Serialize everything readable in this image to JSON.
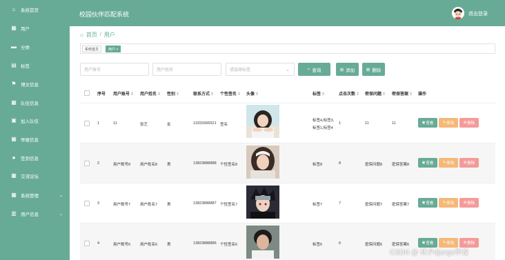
{
  "app": {
    "title": "校园伙伴匹配系统",
    "logout": "退出登录"
  },
  "sidebar": {
    "items": [
      {
        "label": "系统首页",
        "icon": "home-icon"
      },
      {
        "label": "用户",
        "icon": "grid-icon"
      },
      {
        "label": "分类",
        "icon": "card-icon"
      },
      {
        "label": "标签",
        "icon": "doc-icon"
      },
      {
        "label": "博文信息",
        "icon": "flag-icon"
      },
      {
        "label": "队伍信息",
        "icon": "grid-icon"
      },
      {
        "label": "加入队伍",
        "icon": "screen-icon"
      },
      {
        "label": "举报信息",
        "icon": "grid-icon"
      },
      {
        "label": "签到信息",
        "icon": "person-icon"
      },
      {
        "label": "交流论坛",
        "icon": "grid-icon"
      },
      {
        "label": "系统管理",
        "icon": "grid-icon"
      },
      {
        "label": "用户信息",
        "icon": "calendar-icon"
      }
    ]
  },
  "breadcrumb": {
    "home": "首页",
    "sep": "/",
    "current": "用户"
  },
  "tags": [
    {
      "label": "系统首页"
    },
    {
      "label": "用户 ×"
    }
  ],
  "search": {
    "account_placeholder": "用户账号",
    "name_placeholder": "用户姓名",
    "tag_placeholder": "请选择标签",
    "search_label": "查询",
    "add_label": "添加",
    "delete_label": "删除"
  },
  "table": {
    "headers": [
      "序号",
      "用户账号",
      "用户姓名",
      "性别",
      "联系方式",
      "个性签名",
      "头像",
      "标签",
      "点击次数",
      "密保问题",
      "密保答案",
      "操作"
    ],
    "actions": {
      "view": "查看",
      "edit": "修改",
      "delete": "删除"
    },
    "rows": [
      {
        "index": "1",
        "account": "11",
        "name": "张艺",
        "gender": "女",
        "phone": "13333366521",
        "signature": "签名",
        "tags_line1": "标签4,标签3,",
        "tags_line2": "标签1,标签4",
        "clicks": "1",
        "question": "11",
        "answer": "11"
      },
      {
        "index": "2",
        "account": "用户账号8",
        "name": "用户姓名8",
        "gender": "男",
        "phone": "13823888888",
        "signature": "个性签名8",
        "tags_line1": "标签8",
        "tags_line2": "",
        "clicks": "8",
        "question": "密保问题8",
        "answer": "密保答案8"
      },
      {
        "index": "3",
        "account": "用户账号7",
        "name": "用户姓名7",
        "gender": "男",
        "phone": "13823888887",
        "signature": "个性签名7",
        "tags_line1": "标签7",
        "tags_line2": "",
        "clicks": "7",
        "question": "密保问题7",
        "answer": "密保答案7"
      },
      {
        "index": "4",
        "account": "用户账号6",
        "name": "用户姓名6",
        "gender": "男",
        "phone": "13823888886",
        "signature": "个性签名6",
        "tags_line1": "标签6",
        "tags_line2": "",
        "clicks": "6",
        "question": "密保问题6",
        "answer": "密保答案6"
      }
    ]
  },
  "watermark": "CSDN @ 林夕django毕设",
  "colors": {
    "accent": "#67ab96",
    "edit": "#f5b877",
    "delete": "#f59a9a"
  }
}
